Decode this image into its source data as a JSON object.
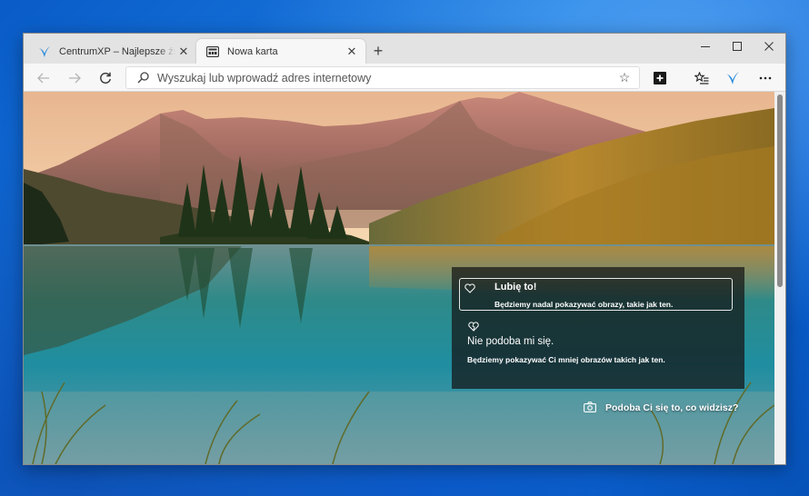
{
  "browser": {
    "tabs": [
      {
        "title": "CentrumXP – Najlepsze źródło",
        "active": false,
        "favicon": "centrumxp-bird-icon"
      },
      {
        "title": "Nowa karta",
        "active": true,
        "favicon": "new-tab-page-icon"
      }
    ],
    "new_tab_label": "+",
    "window_controls": {
      "minimize": "minimize-icon",
      "maximize": "maximize-icon",
      "close": "close-icon"
    },
    "address_bar": {
      "value": "",
      "placeholder": "Wyszukaj lub wprowadź adres internetowy"
    },
    "toolbar_icons": [
      "back-arrow-icon",
      "forward-arrow-icon",
      "reload-icon",
      "search-icon",
      "favorite-star-icon",
      "extension-icon",
      "favorites-list-icon",
      "profile-icon",
      "more-icon"
    ]
  },
  "newtab": {
    "feedback": {
      "like_label": "Lubię to!",
      "like_desc": "Będziemy nadal pokazywać obrazy, takie jak ten.",
      "dislike_label": "Nie podoba mi się.",
      "dislike_desc": "Będziemy pokazywać Ci mniej obrazów takich jak ten."
    },
    "image_question": "Podoba Ci się to, co widzisz?"
  },
  "colors": {
    "desktop": "#0d63d4",
    "tab_strip": "#e3e3e3",
    "toolbar": "#f7f7f7",
    "card_overlay": "#141414"
  }
}
